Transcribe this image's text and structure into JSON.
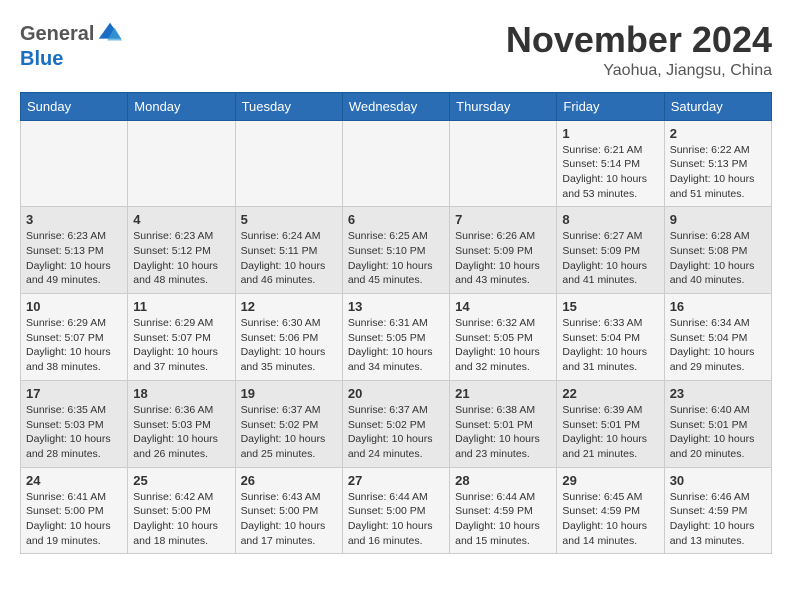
{
  "header": {
    "logo": {
      "general": "General",
      "blue": "Blue"
    },
    "title": "November 2024",
    "location": "Yaohua, Jiangsu, China"
  },
  "weekdays": [
    "Sunday",
    "Monday",
    "Tuesday",
    "Wednesday",
    "Thursday",
    "Friday",
    "Saturday"
  ],
  "weeks": [
    [
      {
        "day": "",
        "info": ""
      },
      {
        "day": "",
        "info": ""
      },
      {
        "day": "",
        "info": ""
      },
      {
        "day": "",
        "info": ""
      },
      {
        "day": "",
        "info": ""
      },
      {
        "day": "1",
        "info": "Sunrise: 6:21 AM\nSunset: 5:14 PM\nDaylight: 10 hours and 53 minutes."
      },
      {
        "day": "2",
        "info": "Sunrise: 6:22 AM\nSunset: 5:13 PM\nDaylight: 10 hours and 51 minutes."
      }
    ],
    [
      {
        "day": "3",
        "info": "Sunrise: 6:23 AM\nSunset: 5:13 PM\nDaylight: 10 hours and 49 minutes."
      },
      {
        "day": "4",
        "info": "Sunrise: 6:23 AM\nSunset: 5:12 PM\nDaylight: 10 hours and 48 minutes."
      },
      {
        "day": "5",
        "info": "Sunrise: 6:24 AM\nSunset: 5:11 PM\nDaylight: 10 hours and 46 minutes."
      },
      {
        "day": "6",
        "info": "Sunrise: 6:25 AM\nSunset: 5:10 PM\nDaylight: 10 hours and 45 minutes."
      },
      {
        "day": "7",
        "info": "Sunrise: 6:26 AM\nSunset: 5:09 PM\nDaylight: 10 hours and 43 minutes."
      },
      {
        "day": "8",
        "info": "Sunrise: 6:27 AM\nSunset: 5:09 PM\nDaylight: 10 hours and 41 minutes."
      },
      {
        "day": "9",
        "info": "Sunrise: 6:28 AM\nSunset: 5:08 PM\nDaylight: 10 hours and 40 minutes."
      }
    ],
    [
      {
        "day": "10",
        "info": "Sunrise: 6:29 AM\nSunset: 5:07 PM\nDaylight: 10 hours and 38 minutes."
      },
      {
        "day": "11",
        "info": "Sunrise: 6:29 AM\nSunset: 5:07 PM\nDaylight: 10 hours and 37 minutes."
      },
      {
        "day": "12",
        "info": "Sunrise: 6:30 AM\nSunset: 5:06 PM\nDaylight: 10 hours and 35 minutes."
      },
      {
        "day": "13",
        "info": "Sunrise: 6:31 AM\nSunset: 5:05 PM\nDaylight: 10 hours and 34 minutes."
      },
      {
        "day": "14",
        "info": "Sunrise: 6:32 AM\nSunset: 5:05 PM\nDaylight: 10 hours and 32 minutes."
      },
      {
        "day": "15",
        "info": "Sunrise: 6:33 AM\nSunset: 5:04 PM\nDaylight: 10 hours and 31 minutes."
      },
      {
        "day": "16",
        "info": "Sunrise: 6:34 AM\nSunset: 5:04 PM\nDaylight: 10 hours and 29 minutes."
      }
    ],
    [
      {
        "day": "17",
        "info": "Sunrise: 6:35 AM\nSunset: 5:03 PM\nDaylight: 10 hours and 28 minutes."
      },
      {
        "day": "18",
        "info": "Sunrise: 6:36 AM\nSunset: 5:03 PM\nDaylight: 10 hours and 26 minutes."
      },
      {
        "day": "19",
        "info": "Sunrise: 6:37 AM\nSunset: 5:02 PM\nDaylight: 10 hours and 25 minutes."
      },
      {
        "day": "20",
        "info": "Sunrise: 6:37 AM\nSunset: 5:02 PM\nDaylight: 10 hours and 24 minutes."
      },
      {
        "day": "21",
        "info": "Sunrise: 6:38 AM\nSunset: 5:01 PM\nDaylight: 10 hours and 23 minutes."
      },
      {
        "day": "22",
        "info": "Sunrise: 6:39 AM\nSunset: 5:01 PM\nDaylight: 10 hours and 21 minutes."
      },
      {
        "day": "23",
        "info": "Sunrise: 6:40 AM\nSunset: 5:01 PM\nDaylight: 10 hours and 20 minutes."
      }
    ],
    [
      {
        "day": "24",
        "info": "Sunrise: 6:41 AM\nSunset: 5:00 PM\nDaylight: 10 hours and 19 minutes."
      },
      {
        "day": "25",
        "info": "Sunrise: 6:42 AM\nSunset: 5:00 PM\nDaylight: 10 hours and 18 minutes."
      },
      {
        "day": "26",
        "info": "Sunrise: 6:43 AM\nSunset: 5:00 PM\nDaylight: 10 hours and 17 minutes."
      },
      {
        "day": "27",
        "info": "Sunrise: 6:44 AM\nSunset: 5:00 PM\nDaylight: 10 hours and 16 minutes."
      },
      {
        "day": "28",
        "info": "Sunrise: 6:44 AM\nSunset: 4:59 PM\nDaylight: 10 hours and 15 minutes."
      },
      {
        "day": "29",
        "info": "Sunrise: 6:45 AM\nSunset: 4:59 PM\nDaylight: 10 hours and 14 minutes."
      },
      {
        "day": "30",
        "info": "Sunrise: 6:46 AM\nSunset: 4:59 PM\nDaylight: 10 hours and 13 minutes."
      }
    ]
  ]
}
